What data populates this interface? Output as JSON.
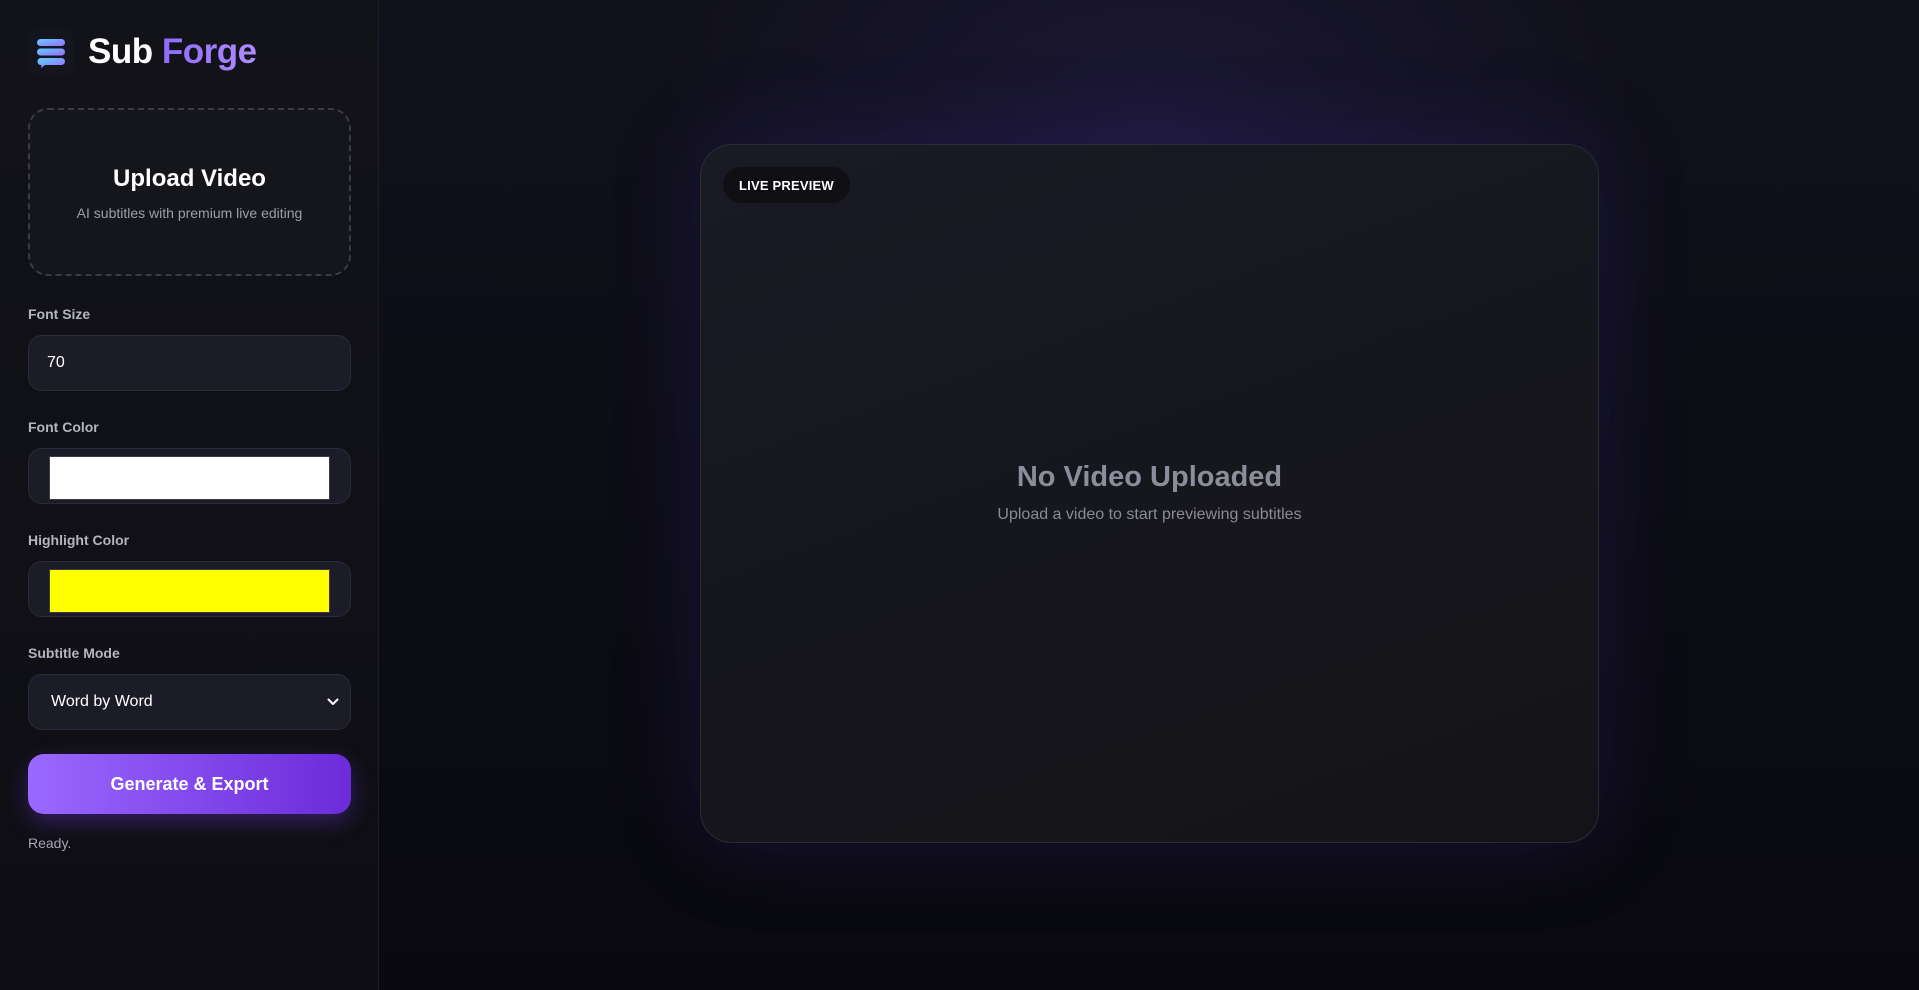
{
  "brand": {
    "name_part1": "Sub",
    "name_part2": "Forge",
    "logo_icon": "chat-layers-icon"
  },
  "upload": {
    "title": "Upload Video",
    "subtitle": "AI subtitles with premium live editing"
  },
  "controls": {
    "font_size": {
      "label": "Font Size",
      "value": "70"
    },
    "font_color": {
      "label": "Font Color",
      "value": "#ffffff"
    },
    "highlight_color": {
      "label": "Highlight Color",
      "value": "#ffff00"
    },
    "subtitle_mode": {
      "label": "Subtitle Mode",
      "selected": "Word by Word"
    }
  },
  "generate_button": {
    "label": "Generate & Export"
  },
  "status": {
    "text": "Ready."
  },
  "preview": {
    "badge": "LIVE PREVIEW",
    "empty_title": "No Video Uploaded",
    "empty_subtitle": "Upload a video to start previewing subtitles"
  },
  "colors": {
    "accent": "#8f6bff",
    "accent_dark": "#6c2bd9",
    "background": "#0b0b12"
  }
}
